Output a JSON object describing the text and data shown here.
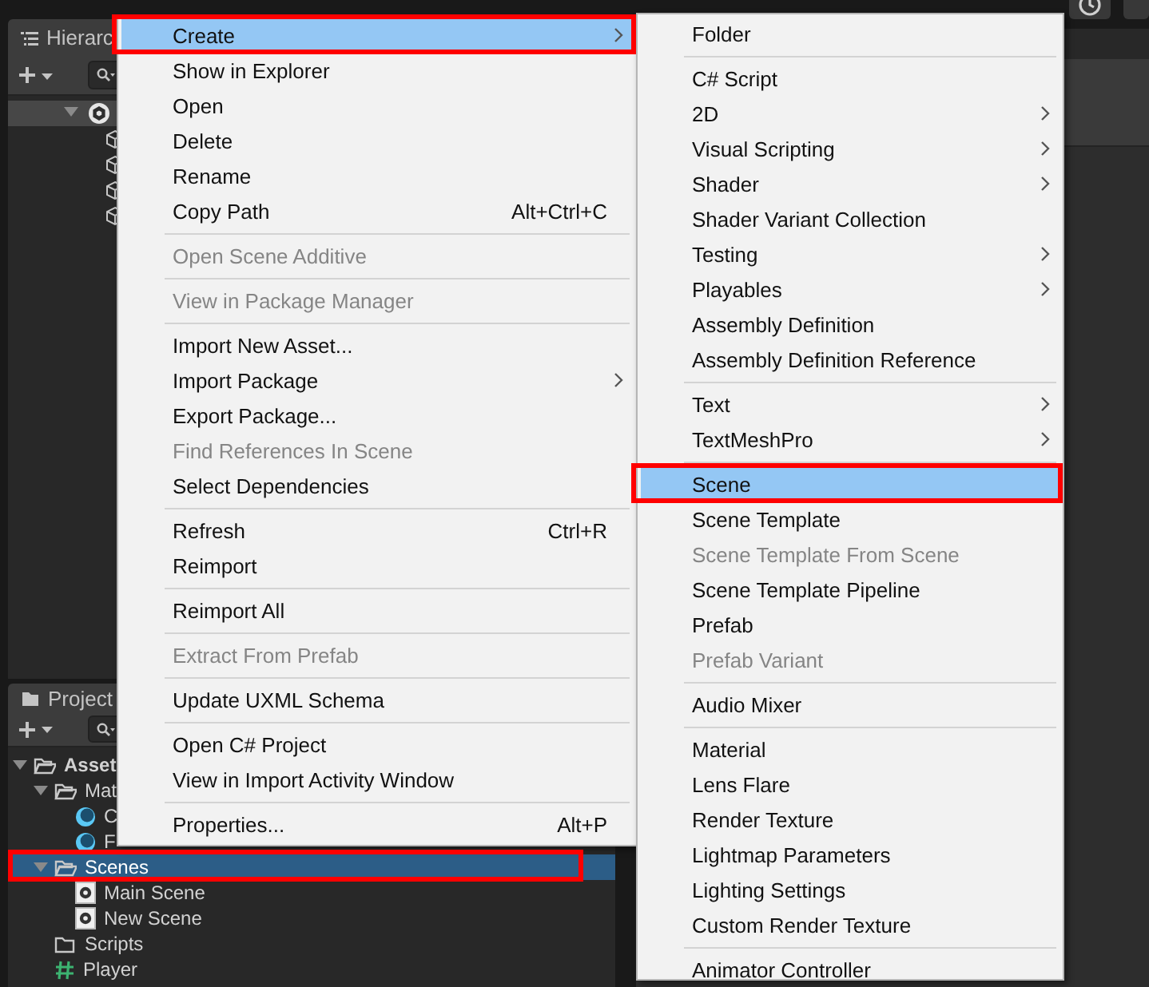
{
  "hierarchy": {
    "tab": "Hierarc",
    "scene_row": {
      "expanded": true,
      "children": [
        {
          "kind": "object"
        },
        {
          "kind": "object"
        },
        {
          "kind": "object"
        },
        {
          "kind": "object"
        }
      ]
    }
  },
  "project": {
    "tab": "Project",
    "tree": [
      {
        "label": "Asset",
        "kind": "folder",
        "expanded": true,
        "selected": false,
        "outlined": false,
        "children": [
          {
            "label": "Mat",
            "kind": "folder",
            "expanded": true,
            "selected": false,
            "outlined": false,
            "children": [
              {
                "label": "C",
                "kind": "material",
                "selected": false,
                "outlined": false
              },
              {
                "label": "F",
                "kind": "material",
                "selected": false,
                "outlined": false
              }
            ]
          },
          {
            "label": "Scenes",
            "kind": "folder",
            "expanded": true,
            "selected": true,
            "outlined": true,
            "children": [
              {
                "label": "Main Scene",
                "kind": "scene",
                "selected": false,
                "outlined": false
              },
              {
                "label": "New Scene",
                "kind": "scene",
                "selected": false,
                "outlined": false
              }
            ]
          },
          {
            "label": "Scripts",
            "kind": "folder",
            "selected": false,
            "outlined": false
          },
          {
            "label": "Player",
            "kind": "script",
            "selected": false,
            "outlined": false
          }
        ]
      }
    ]
  },
  "menus": [
    {
      "items": [
        {
          "kind": "item",
          "label": "Create",
          "submenu": true,
          "disabled": false,
          "selected": true,
          "outlined": true
        },
        {
          "kind": "item",
          "label": "Show in Explorer",
          "submenu": false,
          "disabled": false,
          "selected": false,
          "outlined": false
        },
        {
          "kind": "item",
          "label": "Open",
          "submenu": false,
          "disabled": false,
          "selected": false,
          "outlined": false
        },
        {
          "kind": "item",
          "label": "Delete",
          "submenu": false,
          "disabled": false,
          "selected": false,
          "outlined": false
        },
        {
          "kind": "item",
          "label": "Rename",
          "submenu": false,
          "disabled": false,
          "selected": false,
          "outlined": false
        },
        {
          "kind": "item",
          "label": "Copy Path",
          "shortcut": "Alt+Ctrl+C",
          "submenu": false,
          "disabled": false,
          "selected": false,
          "outlined": false
        },
        {
          "kind": "separator"
        },
        {
          "kind": "item",
          "label": "Open Scene Additive",
          "submenu": false,
          "disabled": true,
          "selected": false,
          "outlined": false
        },
        {
          "kind": "separator"
        },
        {
          "kind": "item",
          "label": "View in Package Manager",
          "submenu": false,
          "disabled": true,
          "selected": false,
          "outlined": false
        },
        {
          "kind": "separator"
        },
        {
          "kind": "item",
          "label": "Import New Asset...",
          "submenu": false,
          "disabled": false,
          "selected": false,
          "outlined": false
        },
        {
          "kind": "item",
          "label": "Import Package",
          "submenu": true,
          "disabled": false,
          "selected": false,
          "outlined": false
        },
        {
          "kind": "item",
          "label": "Export Package...",
          "submenu": false,
          "disabled": false,
          "selected": false,
          "outlined": false
        },
        {
          "kind": "item",
          "label": "Find References In Scene",
          "submenu": false,
          "disabled": true,
          "selected": false,
          "outlined": false
        },
        {
          "kind": "item",
          "label": "Select Dependencies",
          "submenu": false,
          "disabled": false,
          "selected": false,
          "outlined": false
        },
        {
          "kind": "separator"
        },
        {
          "kind": "item",
          "label": "Refresh",
          "shortcut": "Ctrl+R",
          "submenu": false,
          "disabled": false,
          "selected": false,
          "outlined": false
        },
        {
          "kind": "item",
          "label": "Reimport",
          "submenu": false,
          "disabled": false,
          "selected": false,
          "outlined": false
        },
        {
          "kind": "separator"
        },
        {
          "kind": "item",
          "label": "Reimport All",
          "submenu": false,
          "disabled": false,
          "selected": false,
          "outlined": false
        },
        {
          "kind": "separator"
        },
        {
          "kind": "item",
          "label": "Extract From Prefab",
          "submenu": false,
          "disabled": true,
          "selected": false,
          "outlined": false
        },
        {
          "kind": "separator"
        },
        {
          "kind": "item",
          "label": "Update UXML Schema",
          "submenu": false,
          "disabled": false,
          "selected": false,
          "outlined": false
        },
        {
          "kind": "separator"
        },
        {
          "kind": "item",
          "label": "Open C# Project",
          "submenu": false,
          "disabled": false,
          "selected": false,
          "outlined": false
        },
        {
          "kind": "item",
          "label": "View in Import Activity Window",
          "submenu": false,
          "disabled": false,
          "selected": false,
          "outlined": false
        },
        {
          "kind": "separator"
        },
        {
          "kind": "item",
          "label": "Properties...",
          "shortcut": "Alt+P",
          "submenu": false,
          "disabled": false,
          "selected": false,
          "outlined": false
        }
      ]
    },
    {
      "items": [
        {
          "kind": "item",
          "label": "Folder",
          "submenu": false,
          "disabled": false,
          "selected": false,
          "outlined": false
        },
        {
          "kind": "separator"
        },
        {
          "kind": "item",
          "label": "C# Script",
          "submenu": false,
          "disabled": false,
          "selected": false,
          "outlined": false
        },
        {
          "kind": "item",
          "label": "2D",
          "submenu": true,
          "disabled": false,
          "selected": false,
          "outlined": false
        },
        {
          "kind": "item",
          "label": "Visual Scripting",
          "submenu": true,
          "disabled": false,
          "selected": false,
          "outlined": false
        },
        {
          "kind": "item",
          "label": "Shader",
          "submenu": true,
          "disabled": false,
          "selected": false,
          "outlined": false
        },
        {
          "kind": "item",
          "label": "Shader Variant Collection",
          "submenu": false,
          "disabled": false,
          "selected": false,
          "outlined": false
        },
        {
          "kind": "item",
          "label": "Testing",
          "submenu": true,
          "disabled": false,
          "selected": false,
          "outlined": false
        },
        {
          "kind": "item",
          "label": "Playables",
          "submenu": true,
          "disabled": false,
          "selected": false,
          "outlined": false
        },
        {
          "kind": "item",
          "label": "Assembly Definition",
          "submenu": false,
          "disabled": false,
          "selected": false,
          "outlined": false
        },
        {
          "kind": "item",
          "label": "Assembly Definition Reference",
          "submenu": false,
          "disabled": false,
          "selected": false,
          "outlined": false
        },
        {
          "kind": "separator"
        },
        {
          "kind": "item",
          "label": "Text",
          "submenu": true,
          "disabled": false,
          "selected": false,
          "outlined": false
        },
        {
          "kind": "item",
          "label": "TextMeshPro",
          "submenu": true,
          "disabled": false,
          "selected": false,
          "outlined": false
        },
        {
          "kind": "separator"
        },
        {
          "kind": "item",
          "label": "Scene",
          "submenu": false,
          "disabled": false,
          "selected": true,
          "outlined": true
        },
        {
          "kind": "item",
          "label": "Scene Template",
          "submenu": false,
          "disabled": false,
          "selected": false,
          "outlined": false
        },
        {
          "kind": "item",
          "label": "Scene Template From Scene",
          "submenu": false,
          "disabled": true,
          "selected": false,
          "outlined": false
        },
        {
          "kind": "item",
          "label": "Scene Template Pipeline",
          "submenu": false,
          "disabled": false,
          "selected": false,
          "outlined": false
        },
        {
          "kind": "item",
          "label": "Prefab",
          "submenu": false,
          "disabled": false,
          "selected": false,
          "outlined": false
        },
        {
          "kind": "item",
          "label": "Prefab Variant",
          "submenu": false,
          "disabled": true,
          "selected": false,
          "outlined": false
        },
        {
          "kind": "separator"
        },
        {
          "kind": "item",
          "label": "Audio Mixer",
          "submenu": false,
          "disabled": false,
          "selected": false,
          "outlined": false
        },
        {
          "kind": "separator"
        },
        {
          "kind": "item",
          "label": "Material",
          "submenu": false,
          "disabled": false,
          "selected": false,
          "outlined": false
        },
        {
          "kind": "item",
          "label": "Lens Flare",
          "submenu": false,
          "disabled": false,
          "selected": false,
          "outlined": false
        },
        {
          "kind": "item",
          "label": "Render Texture",
          "submenu": false,
          "disabled": false,
          "selected": false,
          "outlined": false
        },
        {
          "kind": "item",
          "label": "Lightmap Parameters",
          "submenu": false,
          "disabled": false,
          "selected": false,
          "outlined": false
        },
        {
          "kind": "item",
          "label": "Lighting Settings",
          "submenu": false,
          "disabled": false,
          "selected": false,
          "outlined": false
        },
        {
          "kind": "item",
          "label": "Custom Render Texture",
          "submenu": false,
          "disabled": false,
          "selected": false,
          "outlined": false
        },
        {
          "kind": "separator"
        },
        {
          "kind": "item",
          "label": "Animator Controller",
          "submenu": false,
          "disabled": false,
          "selected": false,
          "outlined": false
        }
      ]
    }
  ]
}
